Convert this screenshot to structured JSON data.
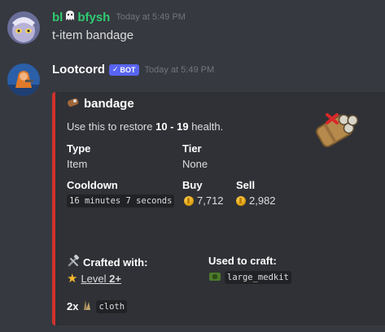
{
  "messages": [
    {
      "username": "bl",
      "username_suffix": "bfysh",
      "timestamp": "Today at 5:49 PM",
      "text": "t-item bandage",
      "name_color": "#2ecc71"
    },
    {
      "username": "Lootcord",
      "bot_tag": "BOT",
      "timestamp": "Today at 5:49 PM",
      "name_color": "#ffffff"
    }
  ],
  "embed": {
    "accent_color": "#d0312d",
    "title": "bandage",
    "description_prefix": "Use this to restore ",
    "description_bold": "10 - 19",
    "description_suffix": " health.",
    "fields": {
      "type_name": "Type",
      "type_value": "Item",
      "tier_name": "Tier",
      "tier_value": "None",
      "cooldown_name": "Cooldown",
      "cooldown_value": "16 minutes 7 seconds",
      "buy_name": "Buy",
      "buy_value": "7,712",
      "sell_name": "Sell",
      "sell_value": "2,982",
      "crafted_name": "Crafted with:",
      "crafted_level_prefix": "Level ",
      "crafted_level_bold": "2+",
      "used_name": "Used to craft:",
      "used_value": "large_medkit",
      "ingredient_qty": "2x",
      "ingredient_name": "cloth"
    }
  }
}
